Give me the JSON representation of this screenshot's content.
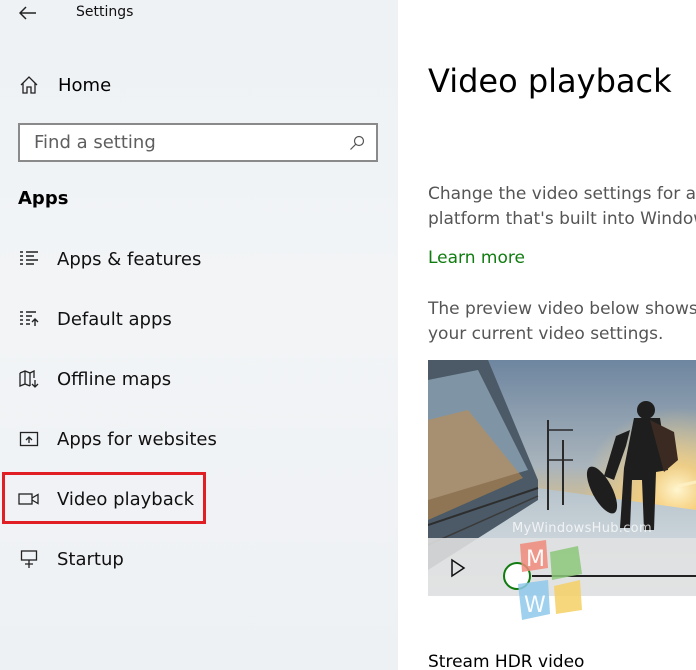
{
  "window": {
    "title": "Settings"
  },
  "sidebar": {
    "home_label": "Home",
    "search": {
      "placeholder": "Find a setting"
    },
    "section_title": "Apps",
    "items": [
      {
        "label": "Apps & features",
        "icon": "list-icon"
      },
      {
        "label": "Default apps",
        "icon": "default-apps-icon"
      },
      {
        "label": "Offline maps",
        "icon": "map-download-icon"
      },
      {
        "label": "Apps for websites",
        "icon": "open-in-app-icon"
      },
      {
        "label": "Video playback",
        "icon": "video-icon",
        "selected": true
      },
      {
        "label": "Startup",
        "icon": "startup-icon"
      }
    ]
  },
  "main": {
    "title": "Video playback",
    "description_line1": "Change the video settings for ap",
    "description_line2": "platform that's built into Window",
    "learn_more": "Learn more",
    "preview_line1": "The preview video below shows y",
    "preview_line2": "your current video settings.",
    "video": {
      "watermark": "MyWindowsHub.com",
      "progress": 0
    },
    "sub_heading": "Stream HDR video"
  },
  "watermark_logo": {
    "letter_top": "M",
    "letter_bottom": "W"
  },
  "colors": {
    "accent": "#107c10",
    "highlight": "#e01e24",
    "sidebar_bg": "#f0f3f5"
  }
}
